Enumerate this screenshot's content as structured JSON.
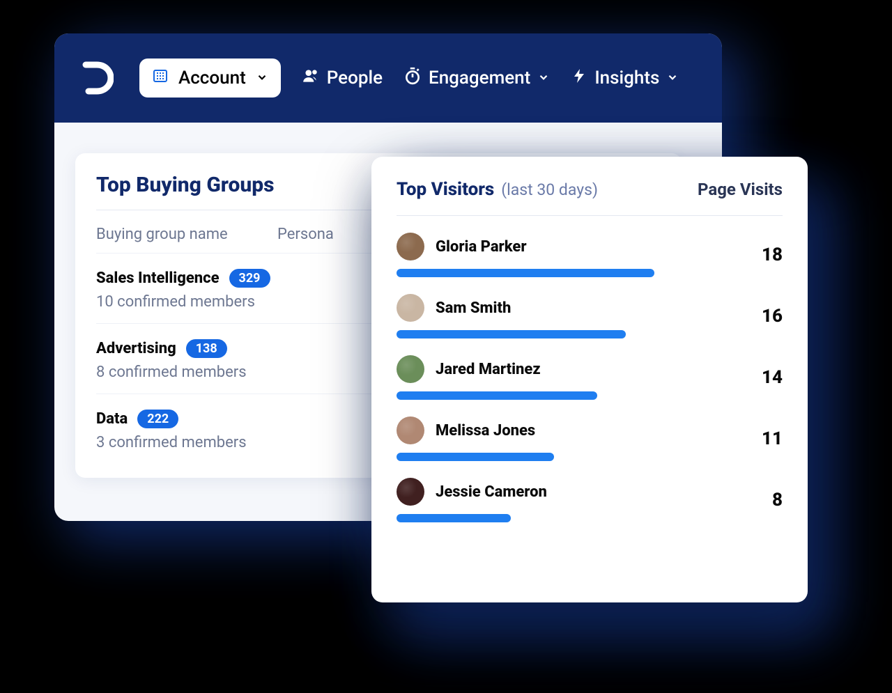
{
  "nav": {
    "account_label": "Account",
    "people_label": "People",
    "engagement_label": "Engagement",
    "insights_label": "Insights"
  },
  "groups": {
    "title": "Top Buying Groups",
    "col_name": "Buying group name",
    "col_persona": "Persona",
    "rows": [
      {
        "name": "Sales Intelligence",
        "count": "329",
        "members": "10 confirmed members"
      },
      {
        "name": "Advertising",
        "count": "138",
        "members": "8 confirmed members"
      },
      {
        "name": "Data",
        "count": "222",
        "members": "3 confirmed members"
      }
    ]
  },
  "visitors": {
    "title": "Top Visitors",
    "subtitle": "(last 30 days)",
    "col_visits": "Page Visits",
    "max": 18,
    "rows": [
      {
        "name": "Gloria Parker",
        "visits": "18",
        "avatarColor": "#8c6a4e"
      },
      {
        "name": "Sam Smith",
        "visits": "16",
        "avatarColor": "#c9b6a3"
      },
      {
        "name": "Jared Martinez",
        "visits": "14",
        "avatarColor": "#6b8e5a"
      },
      {
        "name": "Melissa Jones",
        "visits": "11",
        "avatarColor": "#b08873"
      },
      {
        "name": "Jessie Cameron",
        "visits": "8",
        "avatarColor": "#402020"
      }
    ]
  },
  "chart_data": {
    "type": "bar",
    "title": "Top Visitors (last 30 days)",
    "xlabel": "",
    "ylabel": "Page Visits",
    "categories": [
      "Gloria Parker",
      "Sam Smith",
      "Jared Martinez",
      "Melissa Jones",
      "Jessie Cameron"
    ],
    "values": [
      18,
      16,
      14,
      11,
      8
    ],
    "ylim": [
      0,
      18
    ]
  }
}
